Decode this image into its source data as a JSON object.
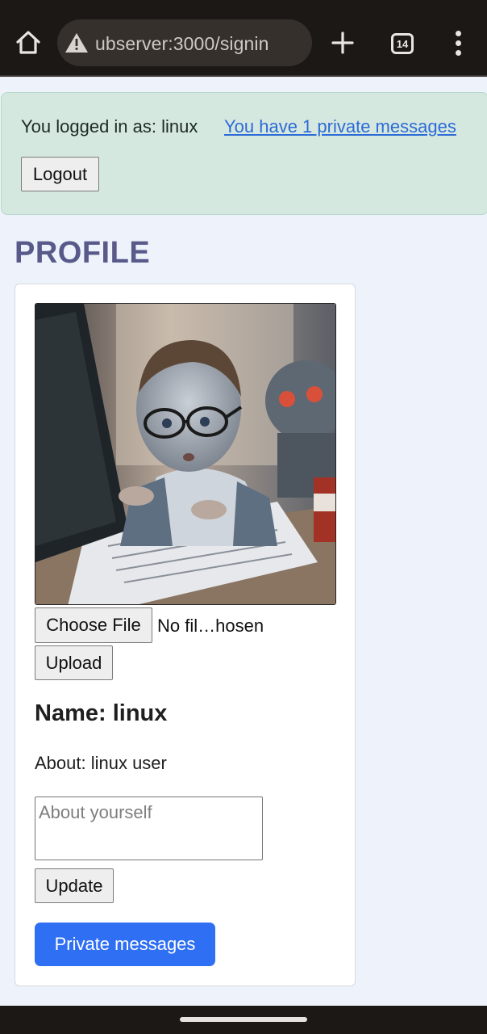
{
  "browser": {
    "url": "ubserver:3000/signin",
    "tab_count": "14",
    "icons": [
      "home-icon",
      "warning-icon",
      "plus-icon",
      "tabs-icon",
      "more-vert-icon"
    ]
  },
  "alert": {
    "logged_in_text": "You logged in as: linux",
    "messages_link": "You have 1 private messages",
    "logout_label": "Logout"
  },
  "profile": {
    "title": "PROFILE",
    "choose_file_label": "Choose File",
    "no_file_text": "No fil…hosen",
    "upload_label": "Upload",
    "name_text": "Name: linux",
    "about_text": "About: linux user",
    "about_placeholder": "About yourself",
    "update_label": "Update",
    "private_messages_label": "Private messages"
  },
  "colors": {
    "chrome_bg": "#1c1816",
    "page_bg": "#eef3fb",
    "alert_bg": "#d5e8e0",
    "link": "#2d6bd6",
    "title": "#59598a",
    "primary_button": "#2f6ff3"
  }
}
